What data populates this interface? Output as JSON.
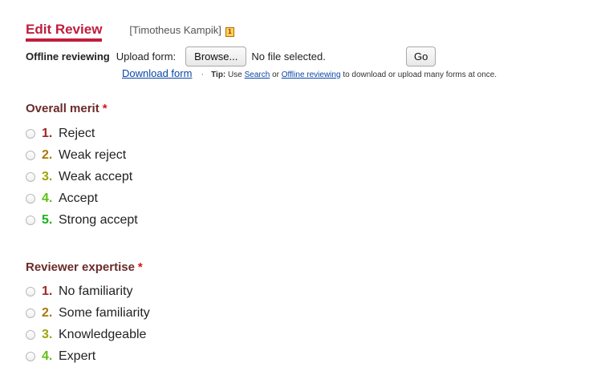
{
  "header": {
    "title": "Edit Review",
    "author": "[Timotheus Kampik]",
    "badge": "1"
  },
  "offline": {
    "label": "Offline reviewing",
    "upload_label": "Upload form:",
    "browse_button": "Browse...",
    "file_status": "No file selected.",
    "go_button": "Go"
  },
  "download": {
    "link": "Download form",
    "separator": "·",
    "tip_label": "Tip:",
    "tip_pre": "Use",
    "tip_search": "Search",
    "tip_or": "or",
    "tip_offline": "Offline reviewing",
    "tip_post": "to download or upload many forms at once."
  },
  "overall_merit": {
    "heading": "Overall merit",
    "required": "*",
    "options": [
      {
        "num": "1.",
        "label": "Reject",
        "color": "#9e2a2a"
      },
      {
        "num": "2.",
        "label": "Weak reject",
        "color": "#a8790a"
      },
      {
        "num": "3.",
        "label": "Weak accept",
        "color": "#9fa30c"
      },
      {
        "num": "4.",
        "label": "Accept",
        "color": "#5fbf19"
      },
      {
        "num": "5.",
        "label": "Strong accept",
        "color": "#19b219"
      }
    ]
  },
  "reviewer_expertise": {
    "heading": "Reviewer expertise",
    "required": "*",
    "options": [
      {
        "num": "1.",
        "label": "No familiarity",
        "color": "#9e2a2a"
      },
      {
        "num": "2.",
        "label": "Some familiarity",
        "color": "#a8790a"
      },
      {
        "num": "3.",
        "label": "Knowledgeable",
        "color": "#9fa30c"
      },
      {
        "num": "4.",
        "label": "Expert",
        "color": "#5fbf19"
      }
    ]
  }
}
